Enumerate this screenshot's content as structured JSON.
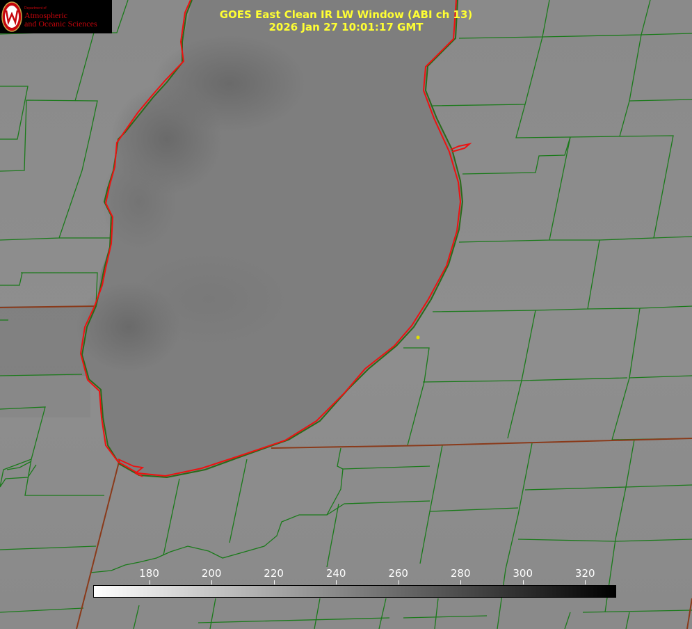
{
  "logo": {
    "department": "Department of",
    "line1": "Atmospheric",
    "line2": "and Oceanic Sciences",
    "colors": {
      "background": "#000000",
      "text": "#c5050c",
      "seal": "#c5050c"
    }
  },
  "title": {
    "line1": "GOES East Clean IR LW Window (ABI ch 13)",
    "line2": "2026 Jan 27 10:01:17 GMT",
    "color": "#ffff33"
  },
  "colorbar": {
    "labels": [
      "180",
      "200",
      "220",
      "240",
      "260",
      "280",
      "300",
      "320"
    ],
    "min": 162,
    "max": 330,
    "start_color": "#ffffff",
    "end_color": "#000000",
    "label_color": "#ffffff"
  },
  "map": {
    "lake_outline_color": "#ff0000",
    "boundary_color": "#1a7a1a",
    "state_line_color": "#8a3a1a",
    "marker_color": "#e0e000",
    "background_color": "#8c8c8c"
  }
}
